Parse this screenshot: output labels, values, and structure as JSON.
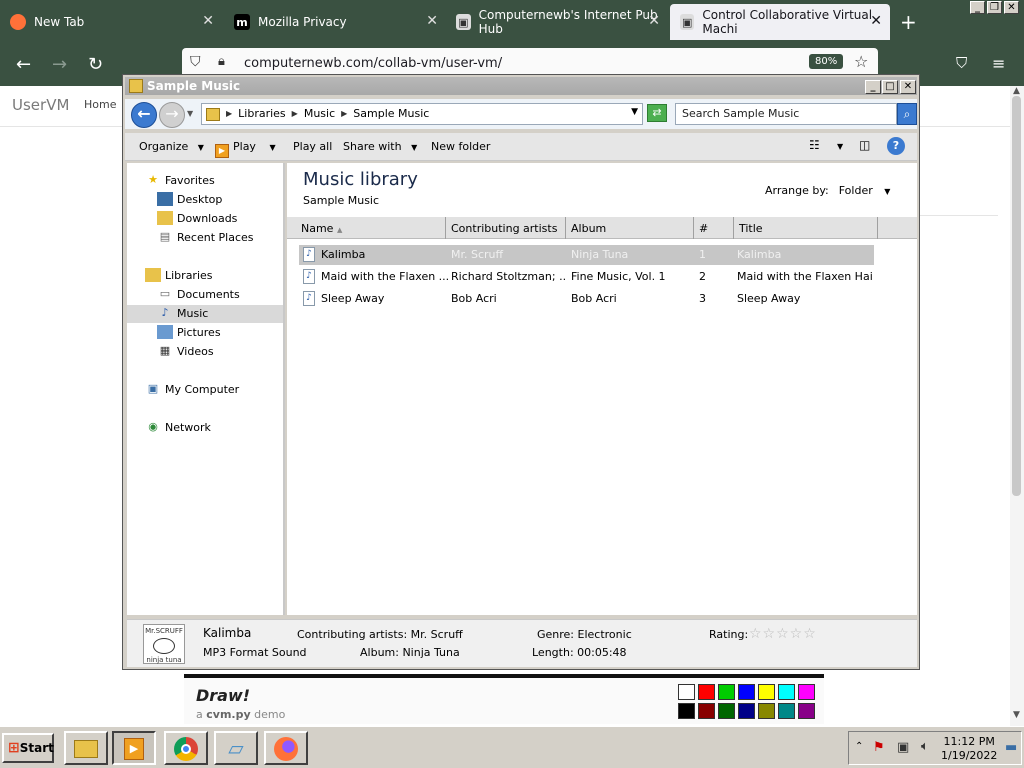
{
  "browser": {
    "tabs": [
      {
        "title": "New Tab",
        "icon": "firefox-icon"
      },
      {
        "title": "Mozilla Privacy",
        "icon": "mozilla-m-icon"
      },
      {
        "title": "Computernewb's Internet Pub Hub",
        "icon": "computer-icon"
      },
      {
        "title": "Control Collaborative Virtual Machi",
        "icon": "computer-icon"
      }
    ],
    "url": "computernewb.com/collab-vm/user-vm/",
    "zoom": "80%"
  },
  "page": {
    "title": "UserVM",
    "nav_home": "Home",
    "draw_title": "Draw!",
    "draw_sub_prefix": "a ",
    "draw_sub_bold": "cvm.py",
    "draw_sub_suffix": " demo",
    "palette": [
      "#ffffff",
      "#ff0000",
      "#00cc00",
      "#0000ff",
      "#ffff00",
      "#00ffff",
      "#ff00ff",
      "#000000",
      "#880000",
      "#006600",
      "#000088",
      "#888800",
      "#008888",
      "#880088"
    ]
  },
  "explorer": {
    "title": "Sample Music",
    "breadcrumbs": [
      "Libraries",
      "Music",
      "Sample Music"
    ],
    "search_placeholder": "Search Sample Music",
    "toolbar": {
      "organize": "Organize",
      "play": "Play",
      "play_all": "Play all",
      "share_with": "Share with",
      "new_folder": "New folder"
    },
    "nav": {
      "favorites": "Favorites",
      "desktop": "Desktop",
      "downloads": "Downloads",
      "recent_places": "Recent Places",
      "libraries": "Libraries",
      "documents": "Documents",
      "music": "Music",
      "pictures": "Pictures",
      "videos": "Videos",
      "my_computer": "My Computer",
      "network": "Network"
    },
    "library_title": "Music library",
    "library_sub": "Sample Music",
    "arrange_label": "Arrange by:",
    "arrange_value": "Folder",
    "columns": [
      "Name",
      "Contributing artists",
      "Album",
      "#",
      "Title"
    ],
    "rows": [
      {
        "name": "Kalimba",
        "artist": "Mr. Scruff",
        "album": "Ninja Tuna",
        "num": "1",
        "title": "Kalimba"
      },
      {
        "name": "Maid with the Flaxen ...",
        "artist": "Richard Stoltzman; ...",
        "album": "Fine Music, Vol. 1",
        "num": "2",
        "title": "Maid with the Flaxen Hair"
      },
      {
        "name": "Sleep Away",
        "artist": "Bob Acri",
        "album": "Bob Acri",
        "num": "3",
        "title": "Sleep Away"
      }
    ],
    "details": {
      "art_text_top": "Mr.SCRUFF",
      "art_text_bottom": "ninja tuna",
      "name": "Kalimba",
      "type": "MP3 Format Sound",
      "artists": "Contributing artists: Mr. Scruff",
      "album": "Album: Ninja Tuna",
      "genre": "Genre: Electronic",
      "length": "Length: 00:05:48",
      "rating_label": "Rating:"
    }
  },
  "taskbar": {
    "start": "Start",
    "time": "11:12 PM",
    "date": "1/19/2022"
  }
}
